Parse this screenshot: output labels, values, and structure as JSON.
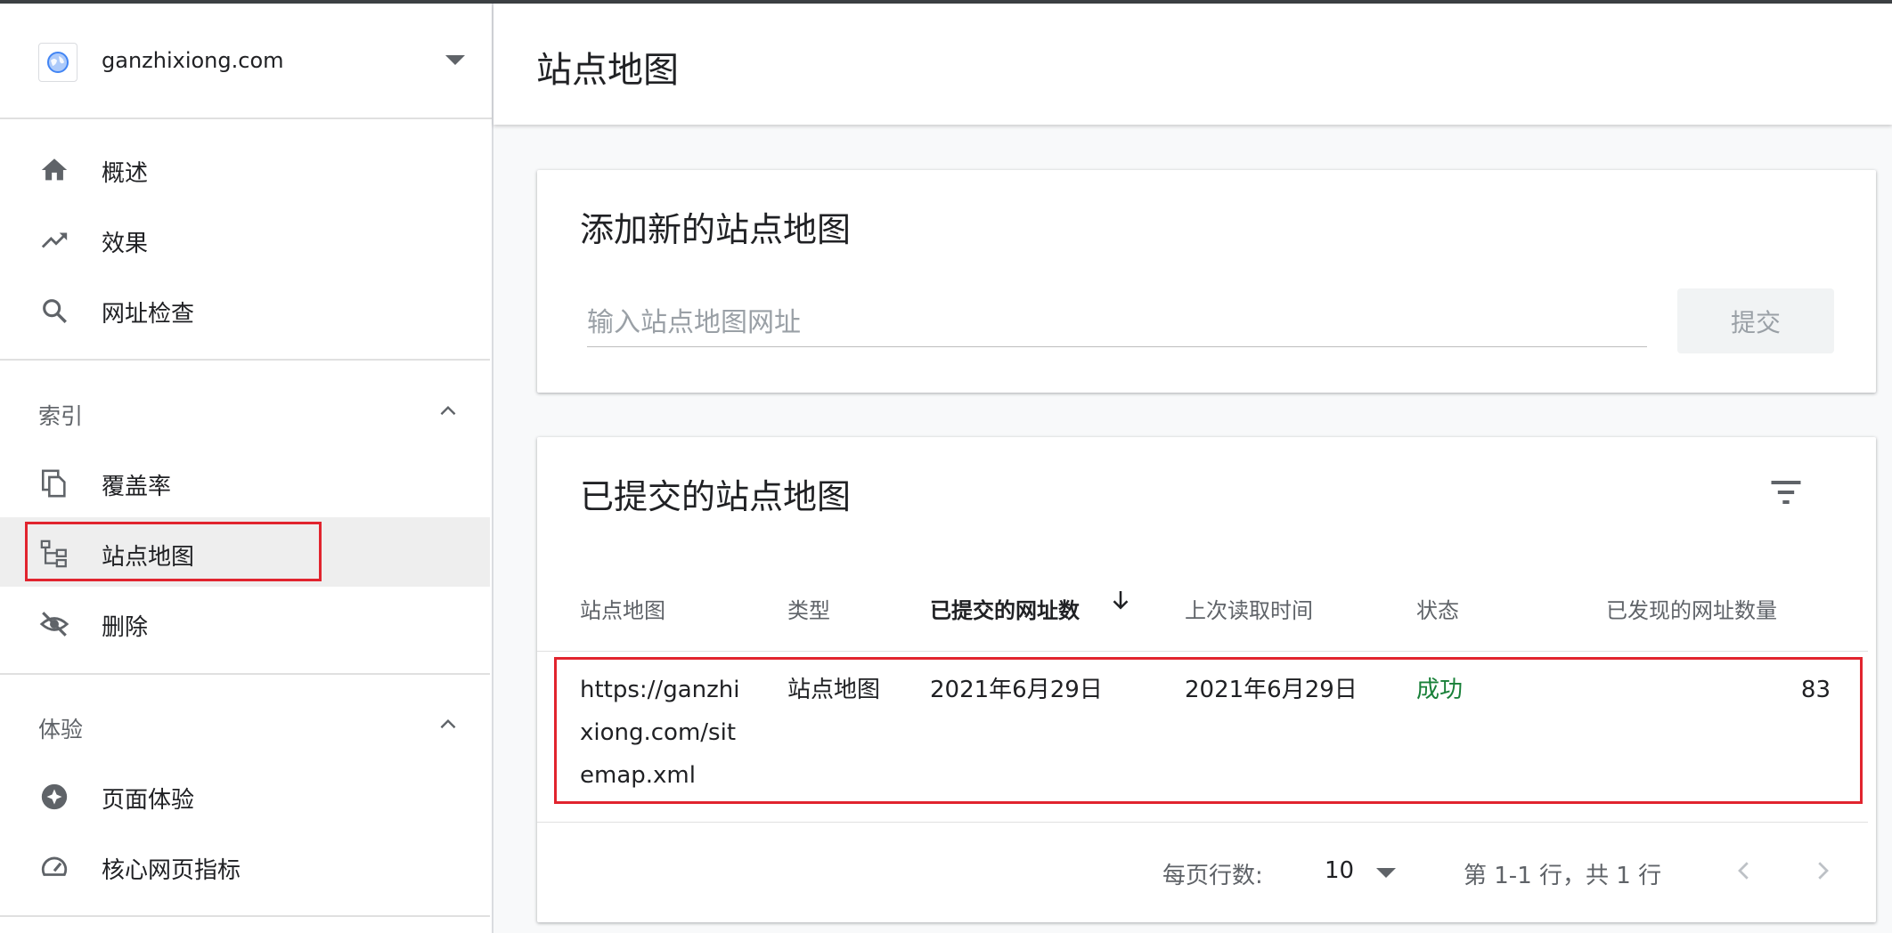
{
  "property": {
    "name": "ganzhixiong.com"
  },
  "nav": {
    "overview": "概述",
    "performance": "效果",
    "url_inspection": "网址检查"
  },
  "index_section": {
    "title": "索引",
    "coverage": "覆盖率",
    "sitemaps": "站点地图",
    "removals": "删除"
  },
  "experience_section": {
    "title": "体验",
    "page_experience": "页面体验",
    "core_web_vitals": "核心网页指标"
  },
  "page": {
    "title": "站点地图"
  },
  "add_card": {
    "title": "添加新的站点地图",
    "input_placeholder": "输入站点地图网址",
    "submit_label": "提交"
  },
  "submitted_card": {
    "title": "已提交的站点地图",
    "columns": {
      "sitemap": "站点地图",
      "type": "类型",
      "submitted": "已提交的网址数",
      "last_read": "上次读取时间",
      "status": "状态",
      "discovered": "已发现的网址数量"
    },
    "rows": [
      {
        "url_lines": [
          "https://ganzhi",
          "xiong.com/sit",
          "emap.xml"
        ],
        "type": "站点地图",
        "submitted": "2021年6月29日",
        "last_read": "2021年6月29日",
        "status": "成功",
        "discovered": "83"
      }
    ],
    "footer": {
      "rows_per_page_label": "每页行数:",
      "rows_per_page_value": "10",
      "range": "第 1-1 行，共 1 行"
    }
  },
  "colors": {
    "highlight": "#e1242e",
    "success": "#188038",
    "accent": "#4285f4"
  }
}
